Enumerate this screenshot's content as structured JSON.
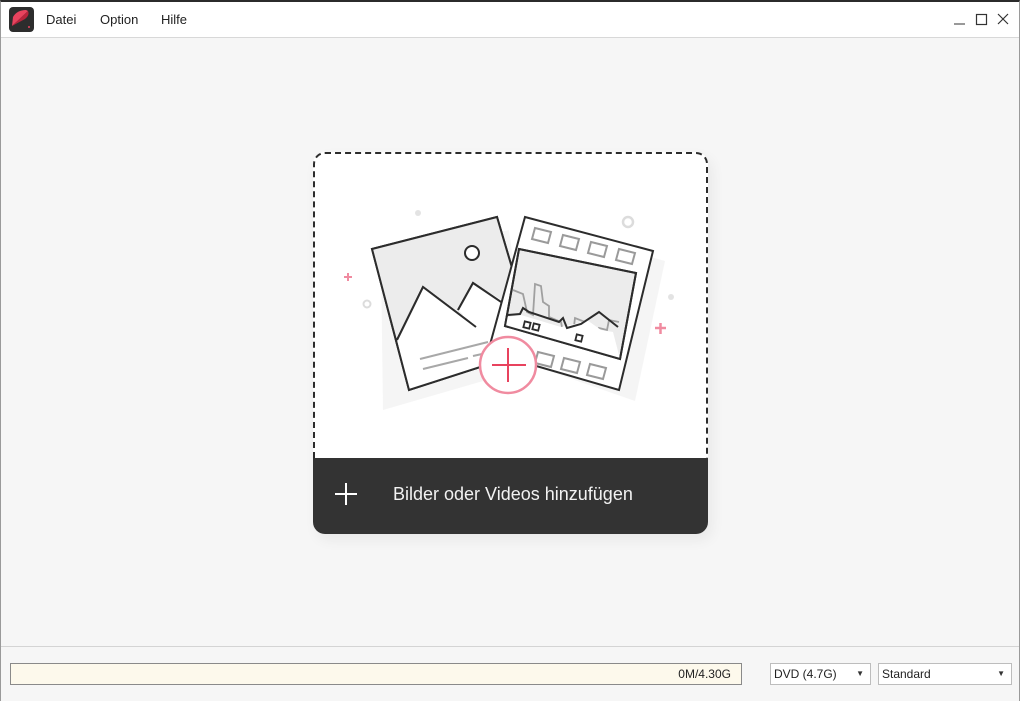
{
  "titlebar": {
    "app_icon": "app-logo-icon",
    "menu": [
      {
        "label": "Datei"
      },
      {
        "label": "Option"
      },
      {
        "label": "Hilfe"
      }
    ],
    "window_controls": [
      "minimize-icon",
      "maximize-icon",
      "close-icon"
    ]
  },
  "main": {
    "dropzone": {
      "illustration": "photo-and-film-add-illustration",
      "add_button_label": "Bilder oder Videos hinzufügen",
      "add_icon": "plus-icon"
    }
  },
  "footer": {
    "capacity": {
      "used_fraction": 0,
      "text": "0M/4.30G"
    },
    "disc_type": {
      "selected": "DVD (4.7G)"
    },
    "quality": {
      "selected": "Standard"
    }
  },
  "colors": {
    "accent": "#e8435e",
    "accent_light": "#f08ba0",
    "dark_bar": "#333333",
    "progress_bg": "#fdf9ec"
  }
}
